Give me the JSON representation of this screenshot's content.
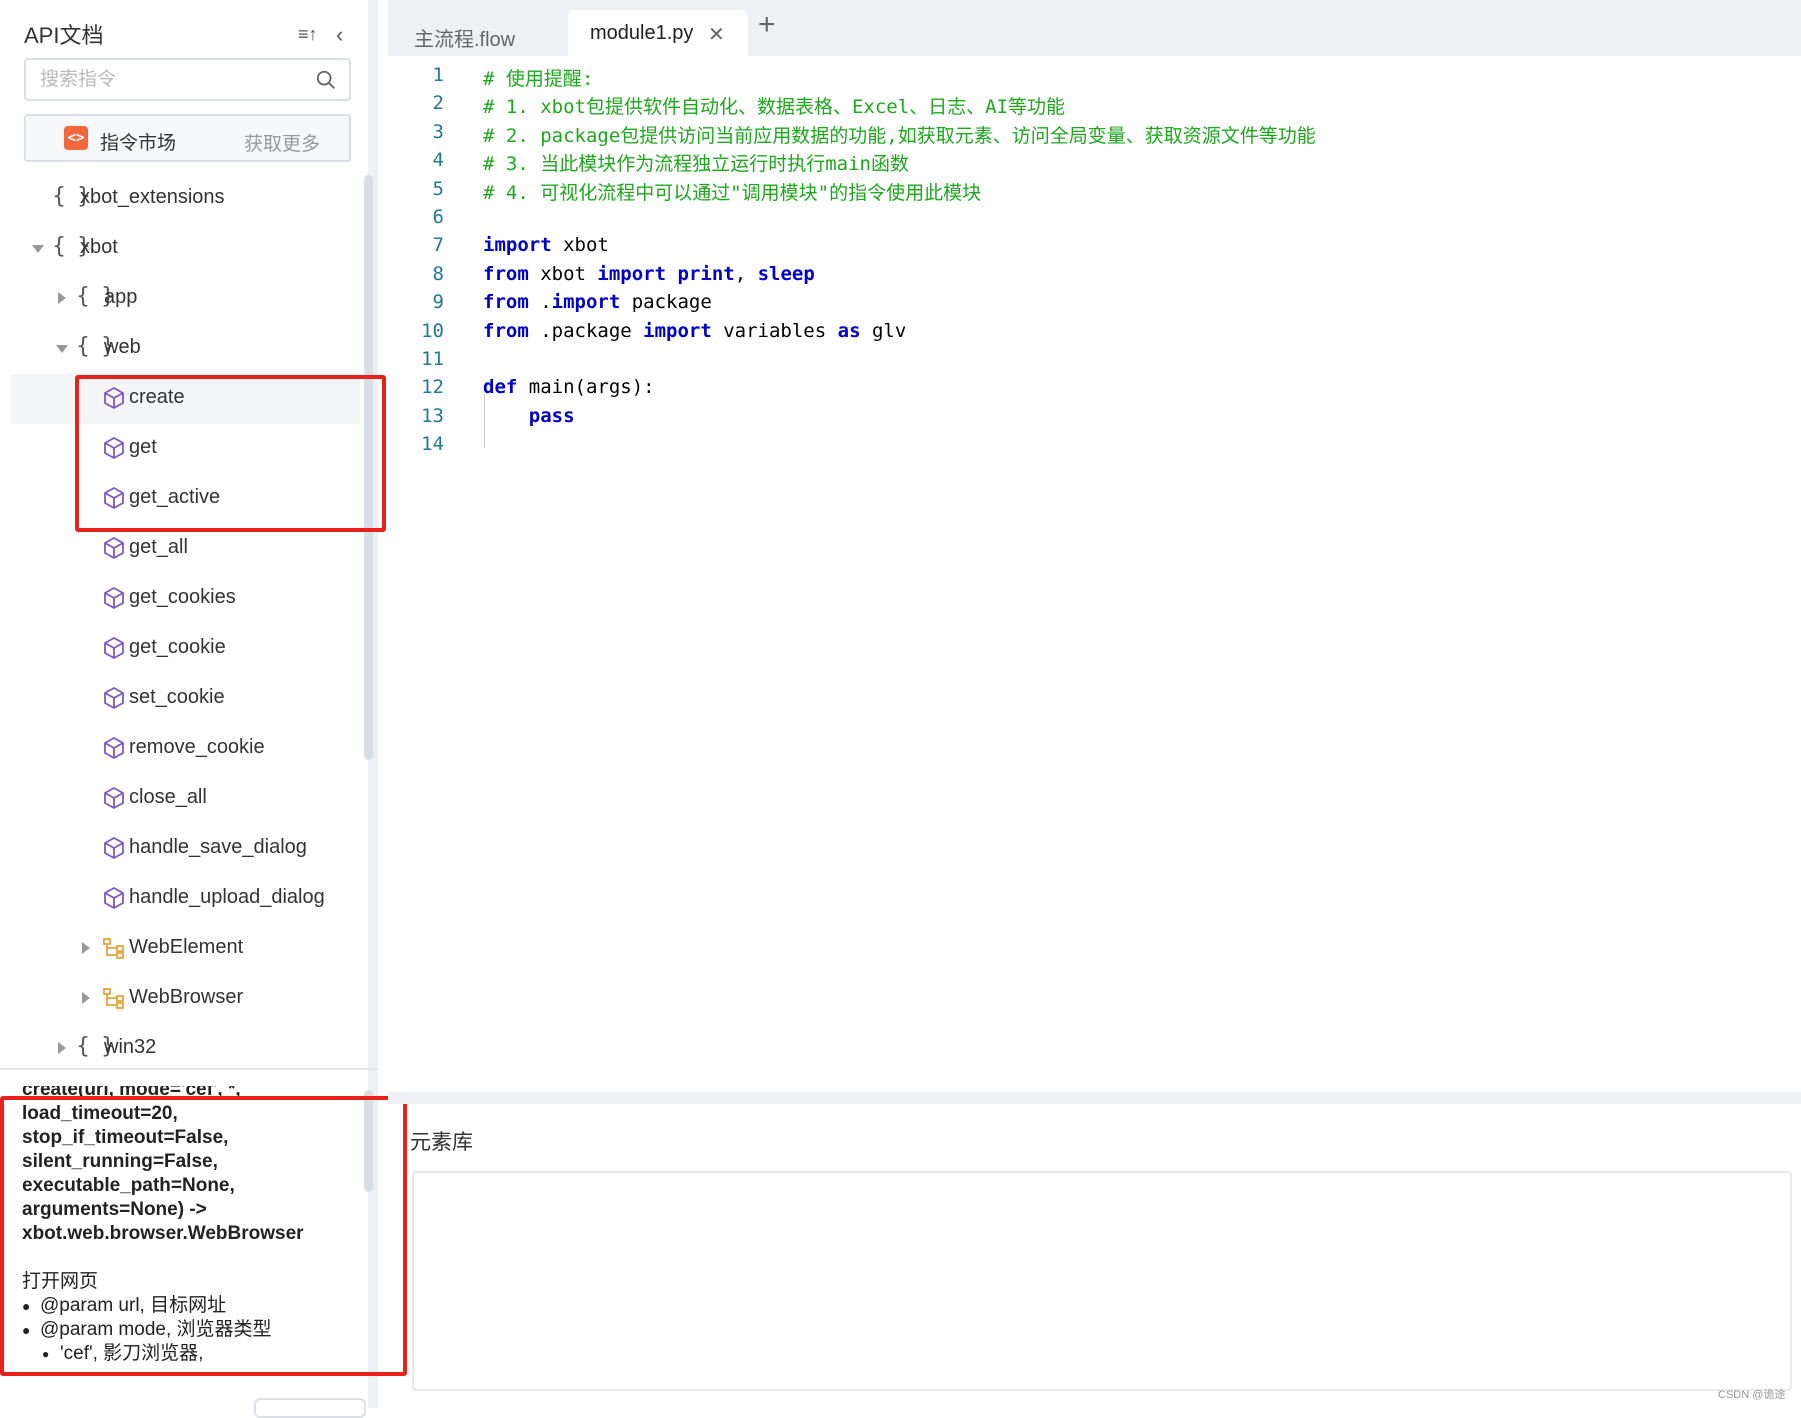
{
  "sidebar": {
    "title": "API文档",
    "sort_icon": "≡↑",
    "collapse_icon": "‹",
    "search_placeholder": "搜索指令",
    "market": {
      "label": "指令市场",
      "more": "获取更多"
    }
  },
  "tree": [
    {
      "label": "xbot_extensions",
      "brace": "{ }",
      "icon": "module-braces"
    },
    {
      "label": "xbot",
      "brace": "{ }",
      "icon": "module-braces",
      "expanded": true
    },
    {
      "label": "app",
      "brace": "{ }",
      "icon": "module-braces",
      "expanded": false
    },
    {
      "label": "web",
      "brace": "{ }",
      "icon": "module-braces",
      "expanded": true
    },
    {
      "label": "create",
      "icon": "cube-icon",
      "selected": true
    },
    {
      "label": "get",
      "icon": "cube-icon"
    },
    {
      "label": "get_active",
      "icon": "cube-icon"
    },
    {
      "label": "get_all",
      "icon": "cube-icon"
    },
    {
      "label": "get_cookies",
      "icon": "cube-icon"
    },
    {
      "label": "get_cookie",
      "icon": "cube-icon"
    },
    {
      "label": "set_cookie",
      "icon": "cube-icon"
    },
    {
      "label": "remove_cookie",
      "icon": "cube-icon"
    },
    {
      "label": "close_all",
      "icon": "cube-icon"
    },
    {
      "label": "handle_save_dialog",
      "icon": "cube-icon"
    },
    {
      "label": "handle_upload_dialog",
      "icon": "cube-icon"
    },
    {
      "label": "WebElement",
      "icon": "class-icon",
      "expanded": false
    },
    {
      "label": "WebBrowser",
      "icon": "class-icon",
      "expanded": false
    },
    {
      "label": "win32",
      "brace": "{ }",
      "icon": "module-braces",
      "expanded": false
    }
  ],
  "doc": {
    "signature": [
      "create(url, mode='cef', *,",
      "load_timeout=20,",
      "stop_if_timeout=False,",
      "silent_running=False,",
      "executable_path=None,",
      "arguments=None) ->",
      "xbot.web.browser.WebBrowser"
    ],
    "description": "打开网页",
    "params": [
      "@param url, 目标网址",
      "@param mode, 浏览器类型"
    ],
    "sub_params": [
      "'cef', 影刀浏览器,"
    ]
  },
  "tabs": [
    {
      "label": "主流程.flow",
      "active": false
    },
    {
      "label": "module1.py",
      "active": true,
      "closable": true
    }
  ],
  "tab_close_icon": "✕",
  "tab_add_icon": "+",
  "code_lines": [
    {
      "n": "1",
      "html": "<span class='cm'># 使用提醒:</span>"
    },
    {
      "n": "2",
      "html": "<span class='cm'># 1. xbot包提供软件自动化、数据表格、Excel、日志、AI等功能</span>"
    },
    {
      "n": "3",
      "html": "<span class='cm'># 2. package包提供访问当前应用数据的功能,如获取元素、访问全局变量、获取资源文件等功能</span>"
    },
    {
      "n": "4",
      "html": "<span class='cm'># 3. 当此模块作为流程独立运行时执行main函数</span>"
    },
    {
      "n": "5",
      "html": "<span class='cm'># 4. 可视化流程中可以通过\"调用模块\"的指令使用此模块</span>"
    },
    {
      "n": "6",
      "html": ""
    },
    {
      "n": "7",
      "html": "<span class='kw'>import</span> xbot"
    },
    {
      "n": "8",
      "html": "<span class='kw'>from</span> xbot <span class='kw'>import</span> <span class='kw'>print</span>, <span class='kw'>sleep</span>"
    },
    {
      "n": "9",
      "html": "<span class='kw'>from</span> .<span class='kw'>import</span> package"
    },
    {
      "n": "10",
      "html": "<span class='kw'>from</span> .package <span class='kw'>import</span> variables <span class='kw'>as</span> glv"
    },
    {
      "n": "11",
      "html": ""
    },
    {
      "n": "12",
      "html": "<span class='kw'>def</span> main(args):"
    },
    {
      "n": "13",
      "html": "    <span class='kw'>pass</span>"
    },
    {
      "n": "14",
      "html": ""
    }
  ],
  "bottom_panel": {
    "title": "元素库"
  },
  "watermark": "CSDN @诡途",
  "colors": {
    "highlight_red": "#e8211a",
    "comment_green": "#1ea81e",
    "keyword_blue": "#0000cc",
    "line_number": "#237893",
    "cube_purple": "#7e57c2",
    "class_orange": "#e8a33a"
  }
}
